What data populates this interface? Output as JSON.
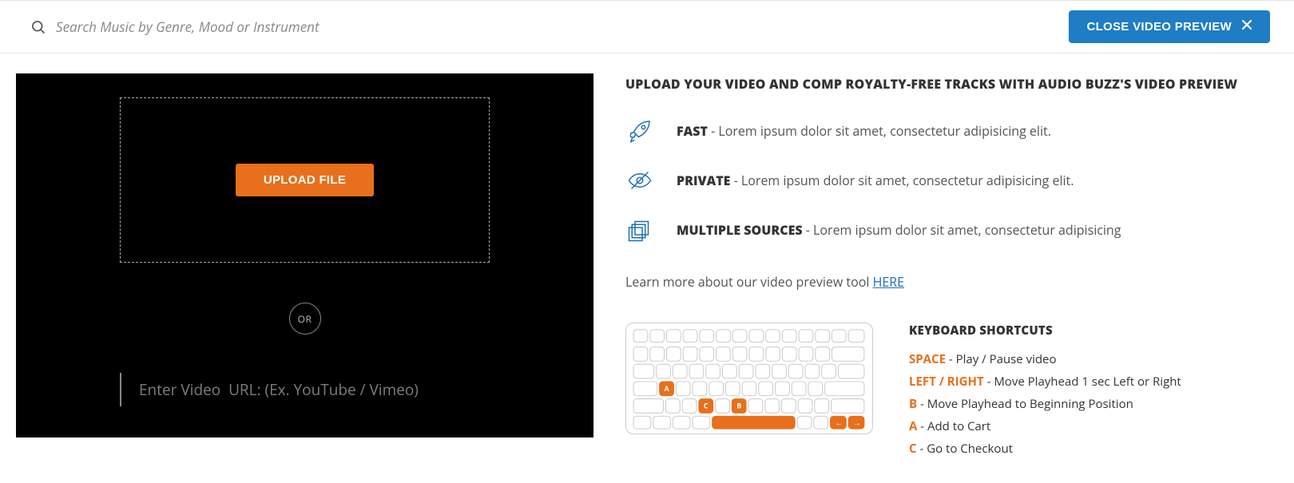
{
  "header": {
    "search_placeholder": "Search Music by Genre, Mood or Instrument",
    "close_label": "CLOSE VIDEO PREVIEW"
  },
  "video_panel": {
    "upload_label": "UPLOAD FILE",
    "or_label": "OR",
    "url_placeholder": "Enter Video  URL: (Ex. YouTube / Vimeo)"
  },
  "info": {
    "title": "UPLOAD YOUR VIDEO AND COMP ROYALTY-FREE TRACKS WITH AUDIO BUZZ'S VIDEO PREVIEW",
    "features": [
      {
        "name": "FAST",
        "desc": " - Lorem ipsum dolor sit amet, consectetur adipisicing elit."
      },
      {
        "name": "PRIVATE",
        "desc": " - Lorem ipsum dolor sit amet, consectetur adipisicing elit."
      },
      {
        "name": "MULTIPLE SOURCES",
        "desc": " - Lorem ipsum dolor sit amet, consectetur adipisicing"
      }
    ],
    "learn_prefix": "Learn more about our video preview tool ",
    "learn_link": "HERE"
  },
  "shortcuts": {
    "title": "KEYBOARD SHORTCUTS",
    "items": [
      {
        "key": "SPACE",
        "sep": " -  ",
        "desc": "Play / Pause video"
      },
      {
        "key": "LEFT / RIGHT",
        "sep": " - ",
        "desc": "Move Playhead 1 sec Left or Right"
      },
      {
        "key": "B",
        "sep": " - ",
        "desc": "Move Playhead to Beginning Position"
      },
      {
        "key": "A",
        "sep": " - ",
        "desc": "Add to Cart"
      },
      {
        "key": "C",
        "sep": " - ",
        "desc": "Go to Checkout"
      }
    ],
    "keyboard_letters": {
      "a": "A",
      "b": "B",
      "c": "C"
    }
  }
}
